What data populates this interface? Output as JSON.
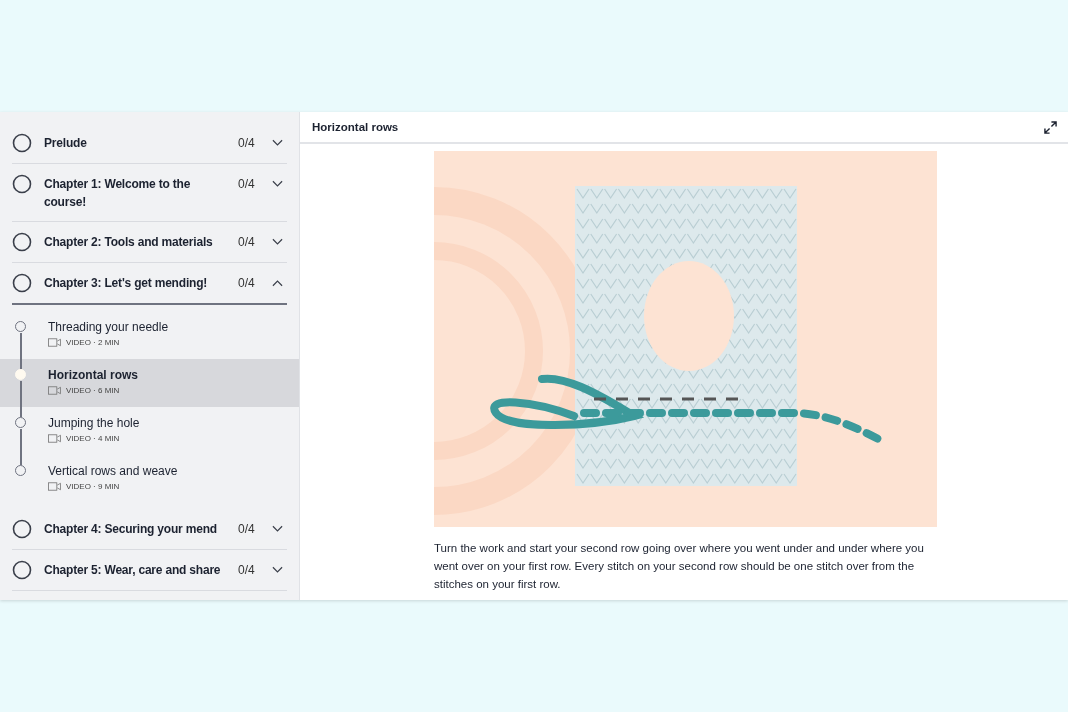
{
  "sidebar": {
    "chapters": [
      {
        "title": "Prelude",
        "progress": "0/4",
        "expanded": false
      },
      {
        "title": "Chapter 1: Welcome to the course!",
        "progress": "0/4",
        "expanded": false
      },
      {
        "title": "Chapter 2: Tools and materials",
        "progress": "0/4",
        "expanded": false
      },
      {
        "title": "Chapter 3: Let's get mending!",
        "progress": "0/4",
        "expanded": true,
        "lessons": [
          {
            "title": "Threading your needle",
            "meta": "VIDEO · 2 MIN",
            "selected": false
          },
          {
            "title": "Horizontal rows",
            "meta": "VIDEO · 6 MIN",
            "selected": true
          },
          {
            "title": "Jumping the hole",
            "meta": "VIDEO · 4 MIN",
            "selected": false
          },
          {
            "title": "Vertical rows and weave",
            "meta": "VIDEO · 9 MIN",
            "selected": false
          }
        ]
      },
      {
        "title": "Chapter 4: Securing your mend",
        "progress": "0/4",
        "expanded": false
      },
      {
        "title": "Chapter 5: Wear, care and share",
        "progress": "0/4",
        "expanded": false
      }
    ]
  },
  "content": {
    "title": "Horizontal rows",
    "description": "Turn the work and start your second row going over where you went under and under where you went over on your first row. Every stitch on your second row should be one stitch over from the stitches on your first row."
  }
}
